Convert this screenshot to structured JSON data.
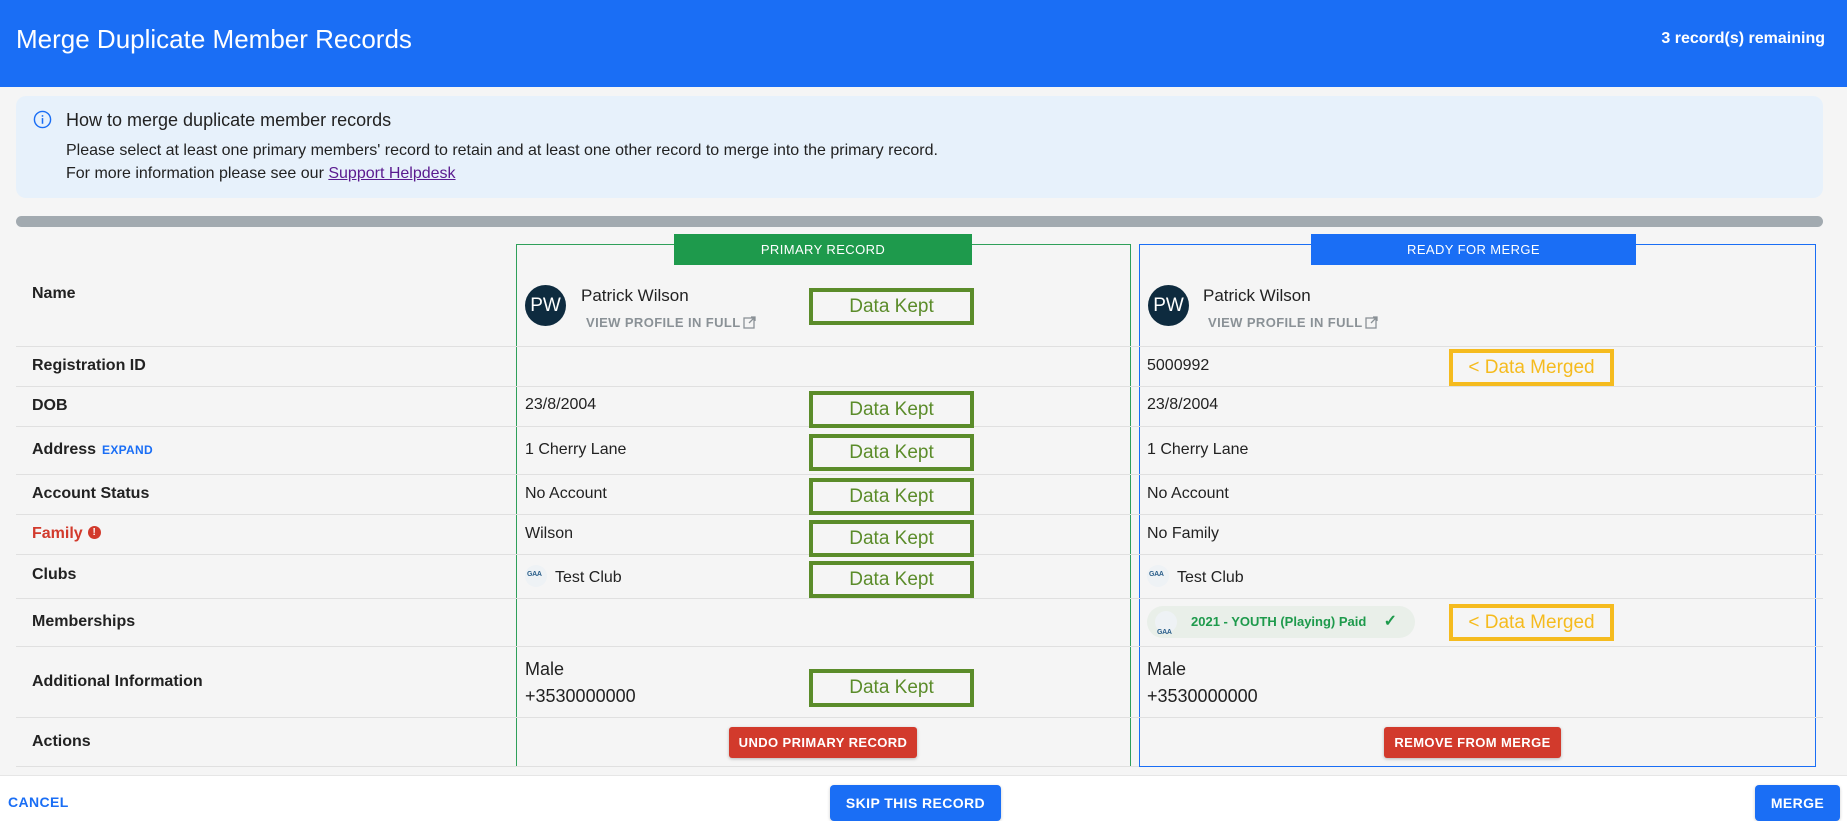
{
  "header": {
    "title": "Merge Duplicate Member Records",
    "remaining": "3 record(s) remaining"
  },
  "info": {
    "heading": "How to merge duplicate member records",
    "line1": "Please select at least one primary members' record to retain and at least one other record to merge into the primary record.",
    "line2_prefix": "For more information please see our ",
    "link": "Support Helpdesk"
  },
  "rows": {
    "name": "Name",
    "registration_id": "Registration ID",
    "dob": "DOB",
    "address": "Address",
    "address_expand": "EXPAND",
    "account_status": "Account Status",
    "family": "Family",
    "clubs": "Clubs",
    "memberships": "Memberships",
    "additional_info": "Additional Information",
    "actions": "Actions"
  },
  "primary": {
    "header": "PRIMARY RECORD",
    "initials": "PW",
    "name": "Patrick Wilson",
    "view_profile": "VIEW PROFILE IN FULL",
    "registration_id": "",
    "dob": "23/8/2004",
    "address": "1 Cherry Lane",
    "account_status": "No Account",
    "family": "Wilson",
    "club": "Test Club",
    "gender": "Male",
    "phone": "+3530000000",
    "action": "UNDO PRIMARY RECORD"
  },
  "merge": {
    "header": "READY FOR MERGE",
    "initials": "PW",
    "name": "Patrick Wilson",
    "view_profile": "VIEW PROFILE IN FULL",
    "registration_id": "5000992",
    "dob": "23/8/2004",
    "address": "1 Cherry Lane",
    "account_status": "No Account",
    "family": "No Family",
    "club": "Test Club",
    "membership": "2021 - YOUTH (Playing) Paid",
    "gender": "Male",
    "phone": "+3530000000",
    "action": "REMOVE FROM MERGE"
  },
  "annotations": {
    "kept": "Data Kept",
    "merged": "< Data Merged"
  },
  "footer": {
    "cancel": "CANCEL",
    "skip": "SKIP THIS RECORD",
    "merge": "MERGE"
  },
  "colors": {
    "brand_blue": "#1a6ef5",
    "primary_green": "#1e9a4c",
    "danger_red": "#d23a2c",
    "kept_green": "#5b8c2a",
    "merged_yellow": "#f5bb1e"
  }
}
